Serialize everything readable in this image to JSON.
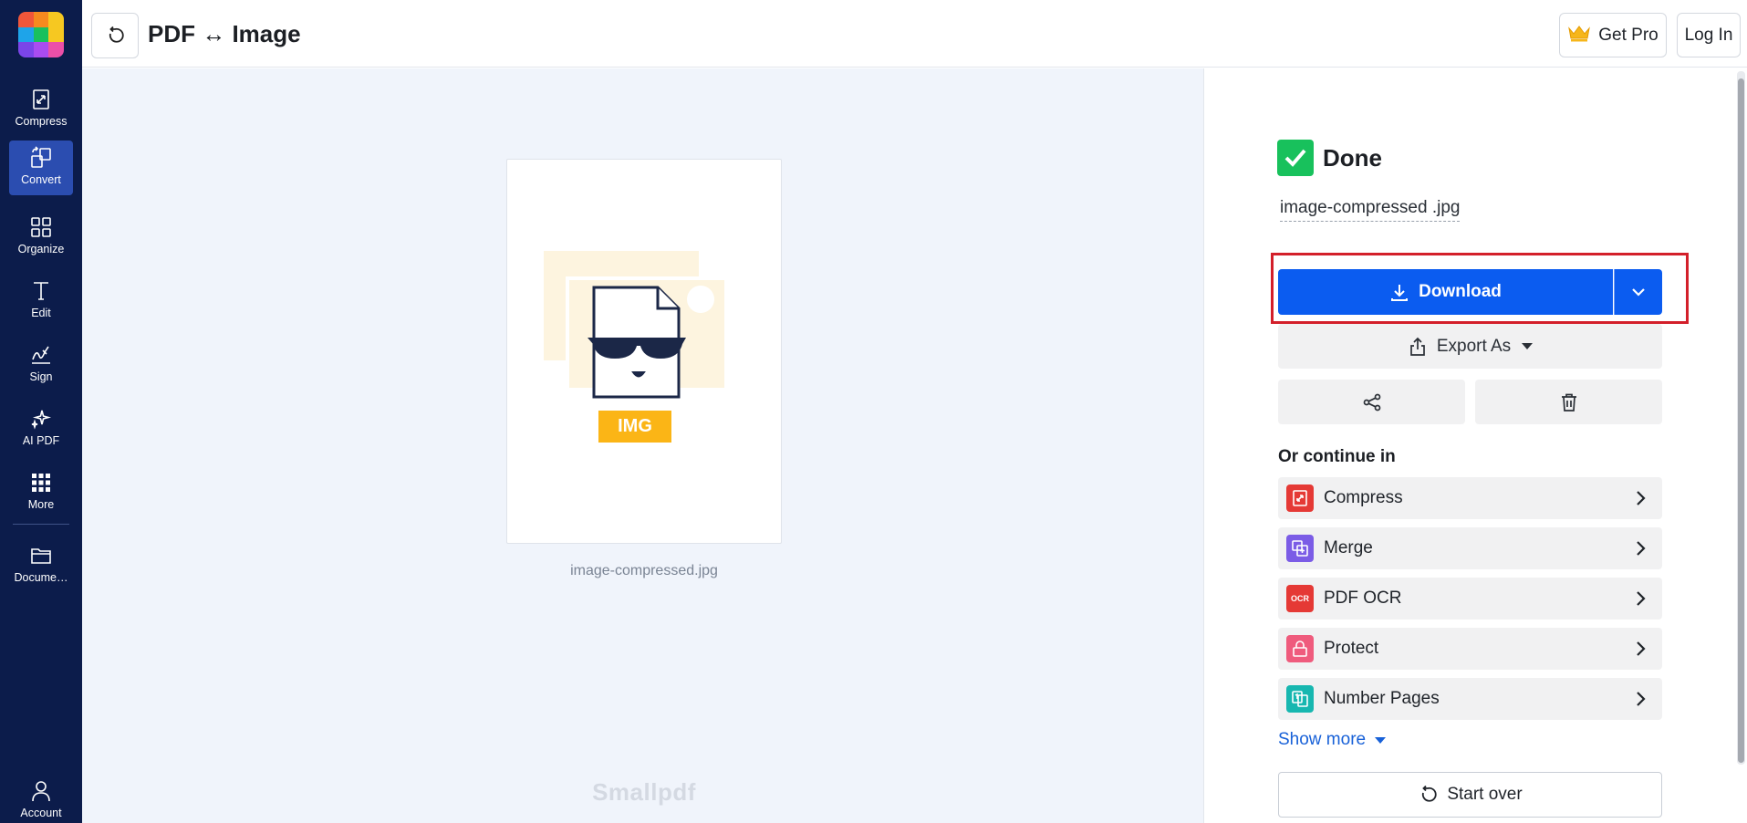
{
  "sidebar": {
    "logo_colors": [
      "#f0563a",
      "#f58a1f",
      "#f6c821",
      "#1ea4e9",
      "#19c05d",
      "#f6c821",
      "#7b45e8",
      "#a94cf0",
      "#ec4fa8"
    ],
    "items": [
      {
        "label": "Compress",
        "icon": "compress-icon",
        "active": false
      },
      {
        "label": "Convert",
        "icon": "convert-icon",
        "active": true
      },
      {
        "label": "Organize",
        "icon": "organize-icon",
        "active": false
      },
      {
        "label": "Edit",
        "icon": "edit-icon",
        "active": false
      },
      {
        "label": "Sign",
        "icon": "sign-icon",
        "active": false
      },
      {
        "label": "AI PDF",
        "icon": "sparkles-icon",
        "active": false
      },
      {
        "label": "More",
        "icon": "grid-dots-icon",
        "active": false
      },
      {
        "label": "Docume…",
        "icon": "folder-icon",
        "active": false
      },
      {
        "label": "Account",
        "icon": "user-icon",
        "active": false
      }
    ]
  },
  "header": {
    "title": "PDF ↔ Image",
    "get_pro_label": "Get Pro",
    "login_label": "Log In"
  },
  "preview": {
    "badge_text": "IMG",
    "file_name": "image-compressed.jpg",
    "watermark": "Smallpdf"
  },
  "result": {
    "status": "Done",
    "output_file_name": "image-compressed .jpg",
    "download_label": "Download",
    "export_label": "Export As",
    "continue_title": "Or continue in",
    "tools": [
      {
        "label": "Compress",
        "icon": "compress-icon",
        "color": "#e53935"
      },
      {
        "label": "Merge",
        "icon": "merge-icon",
        "color": "#7b5ce6"
      },
      {
        "label": "PDF OCR",
        "icon": "ocr-icon",
        "color": "#e53935",
        "icon_text": "OCR"
      },
      {
        "label": "Protect",
        "icon": "lock-icon",
        "color": "#ef5b7d"
      },
      {
        "label": "Number Pages",
        "icon": "number-pages-icon",
        "color": "#17b7b0"
      }
    ],
    "show_more_label": "Show more",
    "start_over_label": "Start over"
  },
  "colors": {
    "sidebar_bg": "#0c1c4b",
    "primary": "#0b5cf0",
    "success": "#18c15c",
    "highlight": "#d31f2a",
    "preview_bg": "#f0f4fb"
  }
}
